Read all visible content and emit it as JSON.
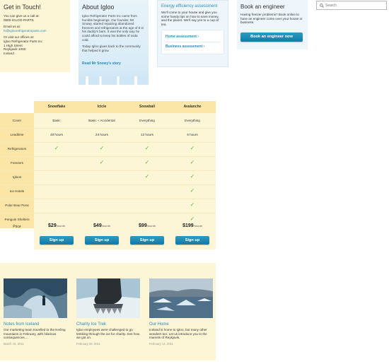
{
  "touch": {
    "title": "Get in Touch!",
    "call_text": "You can give us a call at:",
    "phone": "0800-IGLOO-PARTS",
    "email_label": "Email us at:",
    "email": "hi@igloorefrigeratorparts.com",
    "visit_text": "Or visit our offices at:",
    "addr1": "Igloo Refrigerator Parts Inc",
    "addr2": "1 High Street",
    "addr3": "Reykjavik 1000",
    "addr4": "Iceland"
  },
  "about": {
    "title": "About Igloo",
    "para1": "Igloo Refrigerator Parts Inc came from humble beginnings. Our founder, Mr Snowy, started repairing abandoned freezers and refrigerators at the age of 8 in his daddy's barn. It was the only way he could afford to keep his bottles of soda cold.",
    "para2": "Today Igloo gives back to the community that helped it grow.",
    "story_link": "Read Mr Snowy's story"
  },
  "energy": {
    "title": "Energy efficiency assessment",
    "text": "We'll come to your house and give you some handy tips on how to save money, and the planet. We'll say yes to a cup of tea.",
    "link_home": "Home assessment ›",
    "link_business": "Business assessment ›"
  },
  "book": {
    "title": "Book an engineer",
    "text": "Having freezer problems? Book online to have an engineer come over your house or business.",
    "button": "Book an engineer now"
  },
  "search": {
    "placeholder": "Search"
  },
  "pricing": {
    "plans": [
      "Snowflake",
      "Icicle",
      "Snowball",
      "Avalanche"
    ],
    "rows": [
      {
        "label": "Cover",
        "values": [
          "Basic",
          "Basic + Accidental",
          "Everything",
          "Everything"
        ]
      },
      {
        "label": "Leadtime",
        "values": [
          "48 hours",
          "24 hours",
          "12 hours",
          "6 hours"
        ]
      },
      {
        "label": "Refrigerators",
        "checks": [
          true,
          true,
          true,
          true
        ]
      },
      {
        "label": "Freezers",
        "checks": [
          false,
          true,
          true,
          true
        ]
      },
      {
        "label": "Igloos",
        "checks": [
          false,
          false,
          true,
          true
        ]
      },
      {
        "label": "Ice Hotels",
        "checks": [
          false,
          false,
          false,
          true
        ]
      },
      {
        "label": "Polar Bear Pens",
        "checks": [
          false,
          false,
          false,
          true
        ]
      },
      {
        "label": "Penguin Shelters",
        "checks": [
          false,
          false,
          false,
          true
        ]
      }
    ],
    "price_label": "Price",
    "prices": [
      "$29",
      "$49",
      "$99",
      "$199"
    ],
    "per_month": "/month",
    "signup": "Sign up",
    "check_glyph": "✓"
  },
  "blog": {
    "posts": [
      {
        "title": "Notes from Iceland",
        "text": "Our marketing team travelled to the Kerling mountains in February, with hilarious consequences....",
        "date": "March 15, 2011"
      },
      {
        "title": "Charity Ice Trek",
        "text": "Igloo employees were challenged to go trekking through the ice for charity. See how we got on.",
        "date": "February 28, 2011"
      },
      {
        "title": "Our Home",
        "text": "Iceland is home to Igloo, but many other wonders too. Let us introduce you to the marvels of Reykjavik.",
        "date": "February 14, 2011"
      }
    ]
  },
  "colors": {
    "accent": "#2b8ab8",
    "button": "#1a88b3",
    "check": "#5bb82c",
    "cream": "#fdf6d6",
    "gold": "#fbe6a8"
  }
}
